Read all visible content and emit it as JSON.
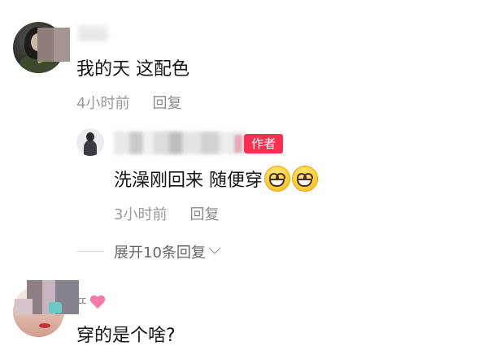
{
  "comments": [
    {
      "text": "我的天 这配色",
      "time": "4小时前",
      "reply_label": "回复",
      "replies": [
        {
          "badge": "作者",
          "text": "洗澡刚回来 随便穿",
          "emojis": [
            "grin-emoji",
            "grin-emoji"
          ],
          "time": "3小时前",
          "reply_label": "回复"
        }
      ],
      "expand_label": "展开10条回复"
    },
    {
      "username": "ㄸ",
      "text": "穿的是个啥?"
    }
  ],
  "colors": {
    "author_badge_bg": "#ff2f4f",
    "meta_text": "#9a9a9a",
    "heart": "#f27aa8"
  }
}
